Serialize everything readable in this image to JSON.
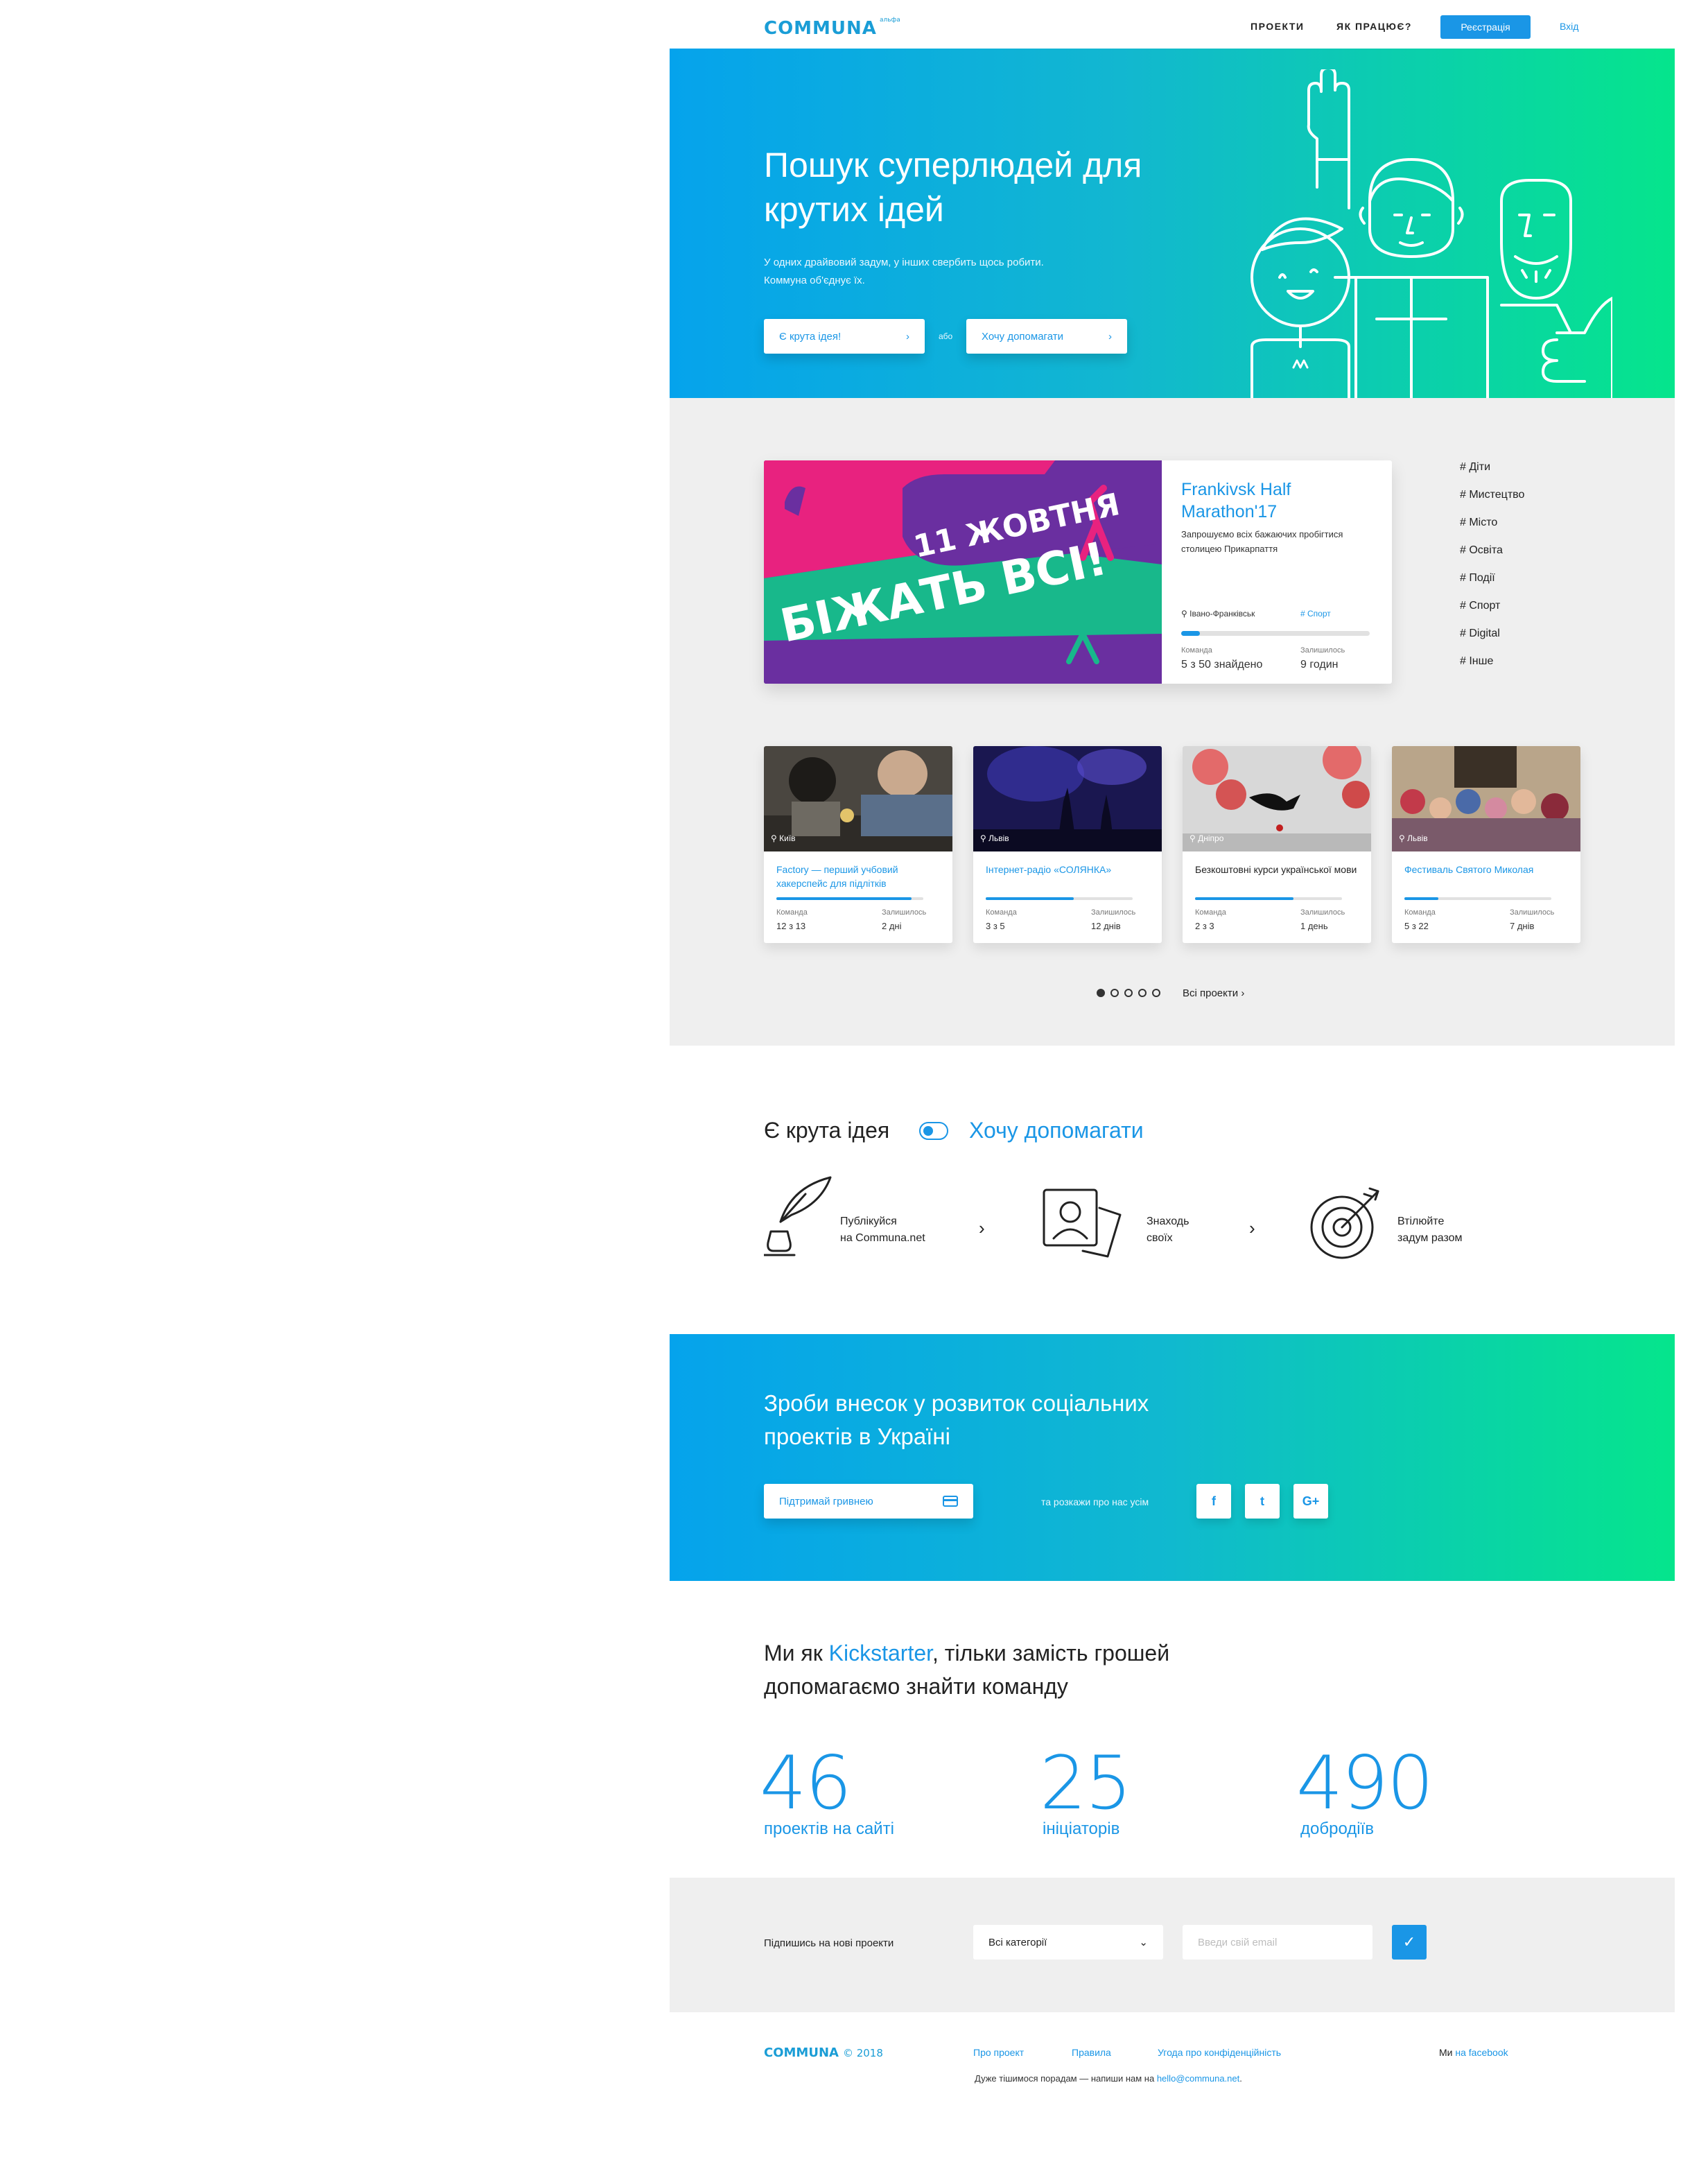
{
  "header": {
    "logo": "COMMUNA",
    "logo_badge": "альфа",
    "nav": [
      "ПРОЕКТИ",
      "ЯК ПРАЦЮЄ?"
    ],
    "register_label": "Реєстрація",
    "login_label": "Вхід"
  },
  "hero": {
    "title": "Пошук суперлюдей для крутих ідей",
    "subtitle": "У одних драйвовий задум, у інших свербить щось робити. Коммуна об'єднує їх.",
    "idea_button": "Є крута ідея!",
    "or_label": "або",
    "help_button": "Хочу допомагати"
  },
  "featured": {
    "image_text_1": "11 ЖОВТНЯ",
    "image_text_2": "БІЖАТЬ ВСІ!",
    "title": "Frankivsk Half Marathon'17",
    "description": "Запрошуємо всіх бажаючих пробігтися столицею Прикарпаття",
    "location": "Івано-Франківськ",
    "tag": "# Спорт",
    "progress": 0.1,
    "team_label": "Команда",
    "team_value": "5 з 50 знайдено",
    "left_label": "Залишилось",
    "left_value": "9 годин"
  },
  "tags": [
    "# Діти",
    "# Мистецтво",
    "# Місто",
    "# Освіта",
    "# Події",
    "# Спорт",
    "# Digital",
    "# Інше"
  ],
  "cards": [
    {
      "location": "Київ",
      "title": "Factory — перший учбовий хакерспейс для підлітків",
      "progress": 0.92,
      "team_label": "Команда",
      "team_value": "12 з 13",
      "left_label": "Залишилось",
      "left_value": "2 дні",
      "title_color": "#1a96e6"
    },
    {
      "location": "Львів",
      "title": "Інтернет-радіо «СОЛЯНКА»",
      "progress": 0.6,
      "team_label": "Команда",
      "team_value": "3 з 5",
      "left_label": "Залишилось",
      "left_value": "12 днів",
      "title_color": "#1a96e6"
    },
    {
      "location": "Дніпро",
      "title": "Безкоштовні курси української мови",
      "progress": 0.67,
      "team_label": "Команда",
      "team_value": "2 з 3",
      "left_label": "Залишилось",
      "left_value": "1 день",
      "title_color": "#222222"
    },
    {
      "location": "Львів",
      "title": "Фестиваль Святого Миколая",
      "progress": 0.23,
      "team_label": "Команда",
      "team_value": "5 з 22",
      "left_label": "Залишилось",
      "left_value": "7 днів",
      "title_color": "#1a96e6"
    }
  ],
  "carousel": {
    "all_projects": "Всі проекти"
  },
  "how": {
    "left_label": "Є крута ідея",
    "right_label": "Хочу допомагати",
    "steps": [
      {
        "line1": "Публікуйся",
        "line2": "на Communa.net",
        "icon": "quill-icon"
      },
      {
        "line1": "Знаходь",
        "line2": "своїх",
        "icon": "profile-card-icon"
      },
      {
        "line1": "Втілюйте",
        "line2": "задум разом",
        "icon": "target-icon"
      }
    ]
  },
  "donate": {
    "title": "Зроби внесок у розвиток соціальних проектів в Україні",
    "button": "Підтримай гривнею",
    "share_text": "та розкажи про нас усім",
    "social": [
      "f",
      "t",
      "G+"
    ]
  },
  "stats": {
    "title_prefix": "Ми як ",
    "title_highlight": "Kickstarter",
    "title_suffix": ", тільки замість грошей допомагаємо знайти команду",
    "items": [
      {
        "value": "46",
        "label": "проектів на сайті"
      },
      {
        "value": "25",
        "label": "ініціаторів"
      },
      {
        "value": "490",
        "label": "добродіїв"
      }
    ]
  },
  "subscribe": {
    "label": "Підпишись на нові проекти",
    "select_value": "Всі категорії",
    "email_placeholder": "Введи свій email"
  },
  "footer": {
    "logo": "COMMUNA",
    "year": "© 2018",
    "links": [
      "Про проект",
      "Правила",
      "Угода про конфіденційність"
    ],
    "note_prefix": "Дуже тішимося порадам — напиши нам на ",
    "note_email": "hello@communa.net",
    "note_suffix": ".",
    "fb_prefix": "Ми ",
    "fb_link": "на facebook"
  },
  "colors": {
    "accent": "#1a96e6",
    "gradient_start": "#05a3ec",
    "gradient_end": "#05e58c",
    "section_bg": "#efefef"
  }
}
